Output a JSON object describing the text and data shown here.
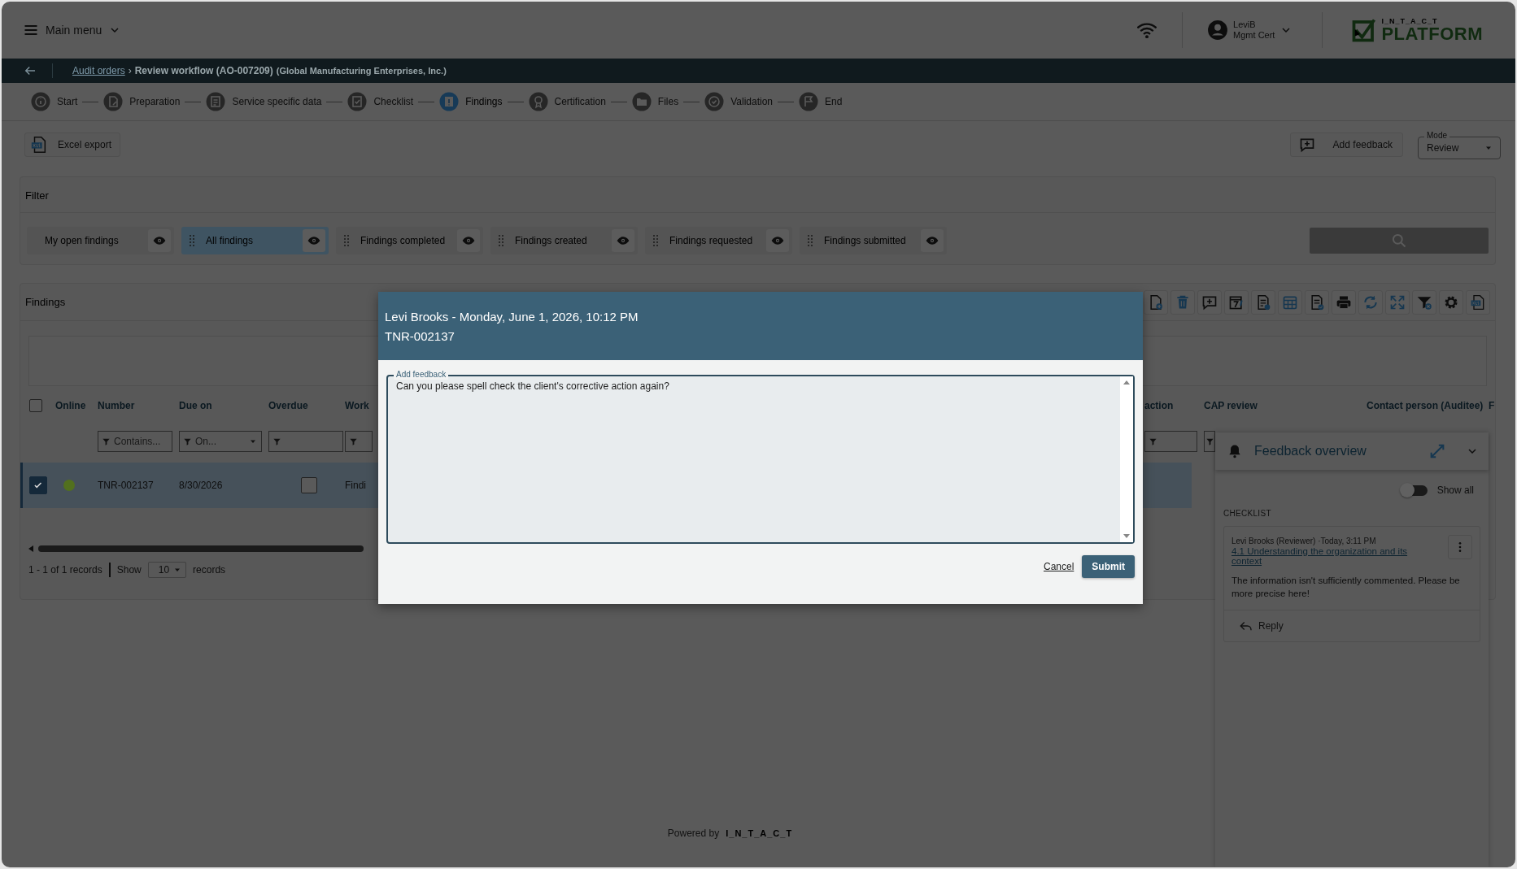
{
  "top_bar": {
    "menu_label": "Main menu",
    "user": {
      "name": "LeviB",
      "role": "Mgmt Cert"
    },
    "logo": {
      "brand": "I_N_T_A_C_T",
      "product": "PLATFORM"
    }
  },
  "breadcrumb": {
    "link": "Audit orders",
    "separator": "›",
    "current": "Review workflow (AO-007209)",
    "detail": "(Global Manufacturing Enterprises, Inc.)"
  },
  "steps": [
    {
      "label": "Start",
      "selected": false
    },
    {
      "label": "Preparation",
      "selected": false
    },
    {
      "label": "Service specific data",
      "selected": false
    },
    {
      "label": "Checklist",
      "selected": false
    },
    {
      "label": "Findings",
      "selected": true
    },
    {
      "label": "Certification",
      "selected": false
    },
    {
      "label": "Files",
      "selected": false
    },
    {
      "label": "Validation",
      "selected": false
    },
    {
      "label": "End",
      "selected": false
    }
  ],
  "toolbar": {
    "export_button": "Excel export",
    "feedback_button": "Add feedback",
    "mode": {
      "label": "Mode",
      "value": "Review"
    }
  },
  "filter": {
    "title": "Filter",
    "presets": [
      {
        "label": "My open findings",
        "selected": false,
        "draggable": false
      },
      {
        "label": "All findings",
        "selected": true,
        "draggable": true
      },
      {
        "label": "Findings completed",
        "selected": false,
        "draggable": true
      },
      {
        "label": "Findings created",
        "selected": false,
        "draggable": true
      },
      {
        "label": "Findings requested",
        "selected": false,
        "draggable": true
      },
      {
        "label": "Findings submitted",
        "selected": false,
        "draggable": true
      }
    ]
  },
  "findings": {
    "title": "Findings",
    "all_selected": false,
    "columns": [
      {
        "label": "Online"
      },
      {
        "label": "Number",
        "filter": {
          "kind": "text",
          "placeholder": "Contains..."
        }
      },
      {
        "label": "Due on",
        "filter": {
          "kind": "select",
          "placeholder": "On..."
        }
      },
      {
        "label": "Overdue",
        "filter": {
          "kind": "text"
        }
      },
      {
        "label": "Work",
        "filter": {
          "kind": "text"
        }
      },
      {
        "label": "action",
        "filter": {
          "kind": "text"
        }
      },
      {
        "label": "CAP review",
        "filter": {
          "kind": "text"
        }
      },
      {
        "label": "Contact person (Auditee)"
      },
      {
        "label": "F"
      }
    ],
    "rows": [
      {
        "selected": true,
        "color": "#52701e",
        "number": "TNR-002137",
        "due_on": "8/30/2026",
        "overdue": false,
        "work": "Findi"
      }
    ],
    "footer": {
      "summary": "1 - 1 of 1 records",
      "show_label": "Show",
      "page_size": "10",
      "records_label": "records"
    }
  },
  "dialog": {
    "title": "Levi Brooks - Monday, June 1, 2026, 10:12 PM",
    "subtitle": "TNR-002137",
    "field_label": "Add feedback",
    "value": "Can you please spell check the client's corrective action again?",
    "cancel": "Cancel",
    "submit": "Submit"
  },
  "feedback_panel": {
    "title": "Feedback overview",
    "show_all": {
      "label": "Show all",
      "on": false
    },
    "section": "CHECKLIST",
    "items": [
      {
        "meta": "Levi Brooks (Reviewer) ·Today, 3:11 PM",
        "link": "4.1 Understanding the organization and its context",
        "text": "The information isn't sufficiently commented. Please be more precise here!",
        "reply": "Reply"
      }
    ]
  },
  "footer": {
    "powered_by": "Powered by",
    "brand": "I_N_T_A_C_T"
  }
}
